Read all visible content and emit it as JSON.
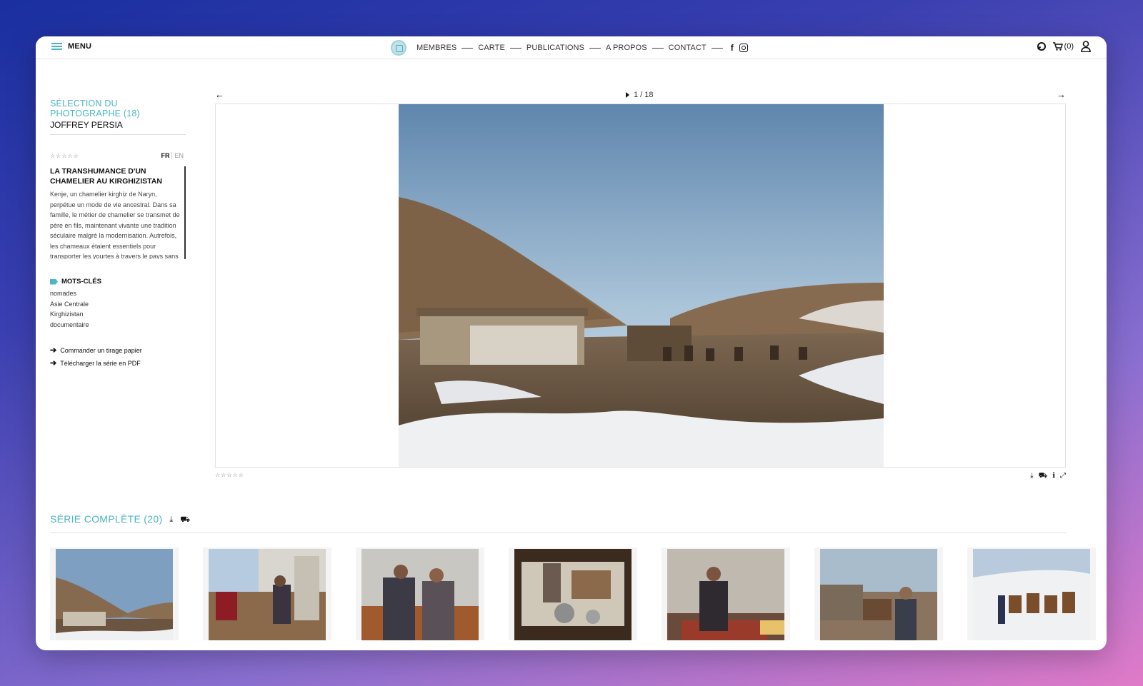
{
  "header": {
    "menu_label": "MENU",
    "nav": [
      "MEMBRES",
      "CARTE",
      "PUBLICATIONS",
      "A PROPOS",
      "CONTACT"
    ],
    "facebook_glyph": "f",
    "cart_count": "(0)"
  },
  "sidebar": {
    "selection_title": "SÉLECTION DU PHOTOGRAPHE (18)",
    "photographer": "JOFFREY PERSIA",
    "rating": "☆☆☆☆☆",
    "lang_active": "FR",
    "lang_inactive": "EN",
    "story_title": "LA TRANSHUMANCE D'UN CHAMELIER AU KIRGHIZISTAN",
    "story_text": "Kenje, un chamelier kirghiz de Naryn, perpétue un mode de vie ancestral. Dans sa famille, le métier de chamelier se transmet de père en fils, maintenant vivante une tradition séculaire malgré la modernisation. Autrefois, les chameaux étaient essentiels pour transporter les yourtes à travers le pays sans l'aide de véhicules modernes.",
    "keywords_label": "MOTS-CLÉS",
    "keywords": [
      "nomades",
      "Asie Centrale",
      "Kirghizistan",
      "documentaire"
    ],
    "link_print": "Commander un tirage papier",
    "link_pdf": "Télécharger la série en PDF"
  },
  "viewer": {
    "prev_glyph": "←",
    "next_glyph": "→",
    "counter": "1 / 18",
    "rating": "☆☆☆☆☆"
  },
  "series": {
    "title": "SÉRIE COMPLÈTE (20)",
    "thumb_count": 7
  },
  "colors": {
    "accent": "#4bb6c4",
    "text": "#111111"
  }
}
